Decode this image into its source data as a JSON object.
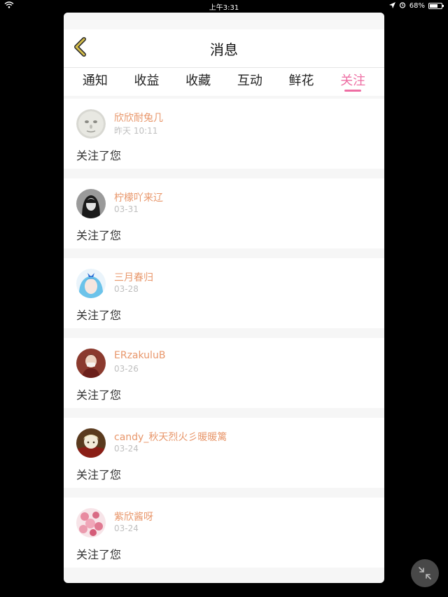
{
  "status_bar": {
    "time": "上午3:31",
    "battery_percent": "68%",
    "battery_level": 0.68
  },
  "nav": {
    "title": "消息"
  },
  "tabs": [
    {
      "label": "通知",
      "active": false
    },
    {
      "label": "收益",
      "active": false
    },
    {
      "label": "收藏",
      "active": false
    },
    {
      "label": "互动",
      "active": false
    },
    {
      "label": "鲜花",
      "active": false
    },
    {
      "label": "关注",
      "active": true
    }
  ],
  "items": [
    {
      "name": "欣欣耐兔几",
      "time": "昨天 10:11",
      "action": "关注了您"
    },
    {
      "name": "柠檬吖来辽",
      "time": "03-31",
      "action": "关注了您"
    },
    {
      "name": "三月春归",
      "time": "03-28",
      "action": "关注了您"
    },
    {
      "name": "ERzakuluB",
      "time": "03-26",
      "action": "关注了您"
    },
    {
      "name": "candy_秋天烈火彡暖暖篱",
      "time": "03-24",
      "action": "关注了您"
    },
    {
      "name": "紫欣酱呀",
      "time": "03-24",
      "action": "关注了您"
    }
  ],
  "colors": {
    "accent": "#ee6ea3",
    "username": "#e8966a",
    "back_arrow": "#d4bc4a"
  }
}
